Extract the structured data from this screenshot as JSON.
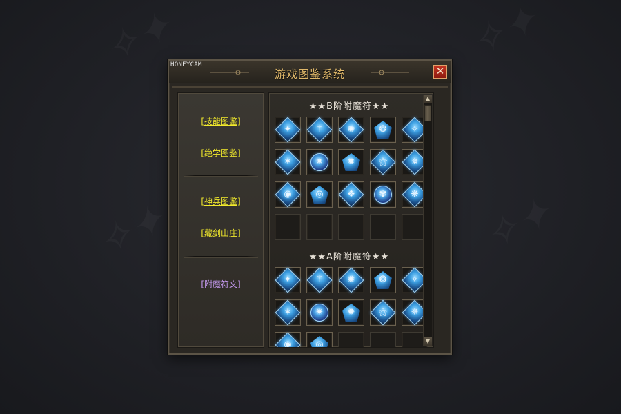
{
  "overlay": {
    "watermark_label": "HONEYCAM"
  },
  "window": {
    "title": "游戏图鉴系统",
    "close_glyph": "✕"
  },
  "left_nav": {
    "group1": [
      {
        "label": "[技能图鉴]",
        "color": "#f2ea2c"
      },
      {
        "label": "[绝学图鉴]",
        "color": "#f2ea2c"
      }
    ],
    "group2": [
      {
        "label": "[神兵图鉴]",
        "color": "#f2ea2c"
      },
      {
        "label": "[藏剑山庄]",
        "color": "#f2ea2c"
      }
    ],
    "group3": [
      {
        "label": "[附魔符文]",
        "color": "#c79bf2",
        "selected": true
      }
    ]
  },
  "sections": [
    {
      "title": "★★B阶附魔符★★",
      "filled_slots": 15,
      "empty_slots": 5
    },
    {
      "title": "★★A阶附魔符★★",
      "filled_slots": 12,
      "empty_slots": 3
    }
  ],
  "scrollbar": {
    "up_glyph": "▲",
    "down_glyph": "▼"
  },
  "colors": {
    "title": "#e0b86a",
    "rune_blue": "#3b9de0",
    "panel_bg": "#2a2722",
    "close_red": "#c53522"
  }
}
